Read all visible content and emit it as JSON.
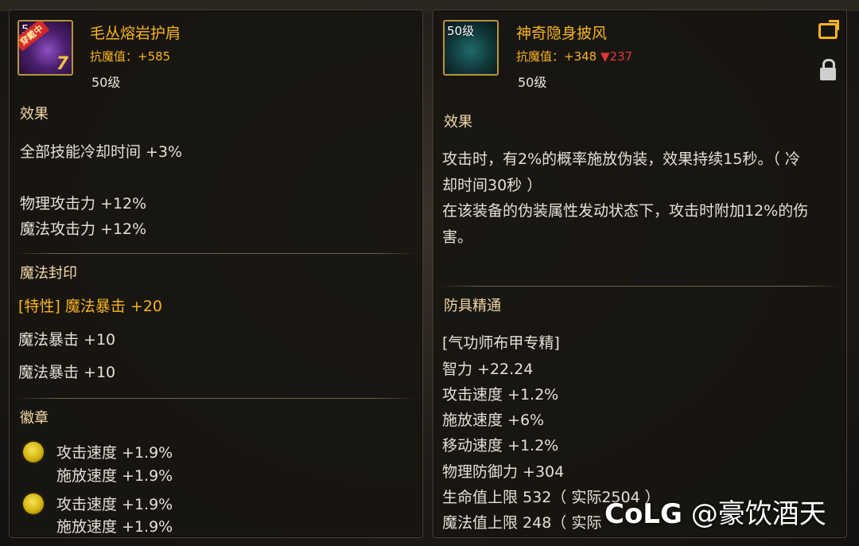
{
  "left_item": {
    "icon_level": "5",
    "badge_label": "穿戴中",
    "icon_number": "7",
    "name": "毛丛熔岩护肩",
    "resist_label": "抗魔值：",
    "resist_value": "+585",
    "level_text": "50级",
    "effect_heading": "效果",
    "effect_lines": [
      "全部技能冷却时间 +3%",
      "物理攻击力 +12%",
      "魔法攻击力 +12%"
    ],
    "seal_heading": "魔法封印",
    "seal_lines": [
      "[特性] 魔法暴击 +20",
      "魔法暴击 +10",
      "魔法暴击 +10"
    ],
    "emblem_heading": "徽章",
    "emblems": [
      {
        "line1": "攻击速度 +1.9%",
        "line2": "施放速度 +1.9%"
      },
      {
        "line1": "攻击速度 +1.9%",
        "line2": "施放速度 +1.9%"
      }
    ]
  },
  "right_item": {
    "icon_level": "50级",
    "name": "神奇隐身披风",
    "resist_label": "抗魔值：",
    "resist_value": "+348",
    "resist_diff": "▼237",
    "level_text": "50级",
    "effect_heading": "效果",
    "effect_lines": [
      "攻击时，有2%的概率施放伪装，效果持续15秒。（ 冷",
      "却时间30秒 ）",
      "在该装备的伪装属性发动状态下，攻击时附加12%的伤",
      "害。"
    ],
    "mastery_heading": "防具精通",
    "mastery_lines": [
      "[气功师布甲专精]",
      "智力 +22.24",
      "攻击速度 +1.2%",
      "施放速度 +6%",
      "移动速度 +1.2%",
      "物理防御力 +304",
      "生命值上限 532（ 实际2504 ）",
      "魔法值上限 248（ 实际"
    ]
  },
  "watermark": {
    "logo": "CoLG",
    "handle": "@豪饮酒天"
  },
  "colors": {
    "gold": "#f6b320",
    "red": "#e2363a",
    "text": "#e4e0d8"
  }
}
